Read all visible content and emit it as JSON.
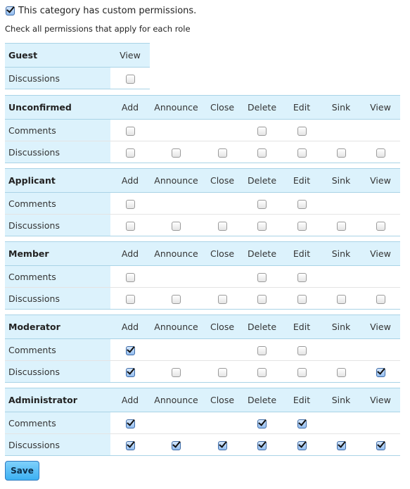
{
  "custom_permissions": {
    "label": "This category has custom permissions.",
    "checked": true
  },
  "hint": "Check all permissions that apply for each role",
  "roles": [
    {
      "name": "Guest",
      "columns": [
        "View"
      ],
      "rows": [
        {
          "label": "Discussions",
          "cells": [
            false
          ]
        }
      ]
    },
    {
      "name": "Unconfirmed",
      "columns": [
        "Add",
        "Announce",
        "Close",
        "Delete",
        "Edit",
        "Sink",
        "View"
      ],
      "rows": [
        {
          "label": "Comments",
          "cells": [
            false,
            null,
            null,
            false,
            false,
            null,
            null
          ]
        },
        {
          "label": "Discussions",
          "cells": [
            false,
            false,
            false,
            false,
            false,
            false,
            false
          ]
        }
      ]
    },
    {
      "name": "Applicant",
      "columns": [
        "Add",
        "Announce",
        "Close",
        "Delete",
        "Edit",
        "Sink",
        "View"
      ],
      "rows": [
        {
          "label": "Comments",
          "cells": [
            false,
            null,
            null,
            false,
            false,
            null,
            null
          ]
        },
        {
          "label": "Discussions",
          "cells": [
            false,
            false,
            false,
            false,
            false,
            false,
            false
          ]
        }
      ]
    },
    {
      "name": "Member",
      "columns": [
        "Add",
        "Announce",
        "Close",
        "Delete",
        "Edit",
        "Sink",
        "View"
      ],
      "rows": [
        {
          "label": "Comments",
          "cells": [
            false,
            null,
            null,
            false,
            false,
            null,
            null
          ]
        },
        {
          "label": "Discussions",
          "cells": [
            false,
            false,
            false,
            false,
            false,
            false,
            false
          ]
        }
      ]
    },
    {
      "name": "Moderator",
      "columns": [
        "Add",
        "Announce",
        "Close",
        "Delete",
        "Edit",
        "Sink",
        "View"
      ],
      "rows": [
        {
          "label": "Comments",
          "cells": [
            true,
            null,
            null,
            false,
            false,
            null,
            null
          ]
        },
        {
          "label": "Discussions",
          "cells": [
            true,
            false,
            false,
            false,
            false,
            false,
            true
          ]
        }
      ]
    },
    {
      "name": "Administrator",
      "columns": [
        "Add",
        "Announce",
        "Close",
        "Delete",
        "Edit",
        "Sink",
        "View"
      ],
      "rows": [
        {
          "label": "Comments",
          "cells": [
            true,
            null,
            null,
            true,
            true,
            null,
            null
          ]
        },
        {
          "label": "Discussions",
          "cells": [
            true,
            true,
            true,
            true,
            true,
            true,
            true
          ]
        }
      ]
    }
  ],
  "save_label": "Save"
}
